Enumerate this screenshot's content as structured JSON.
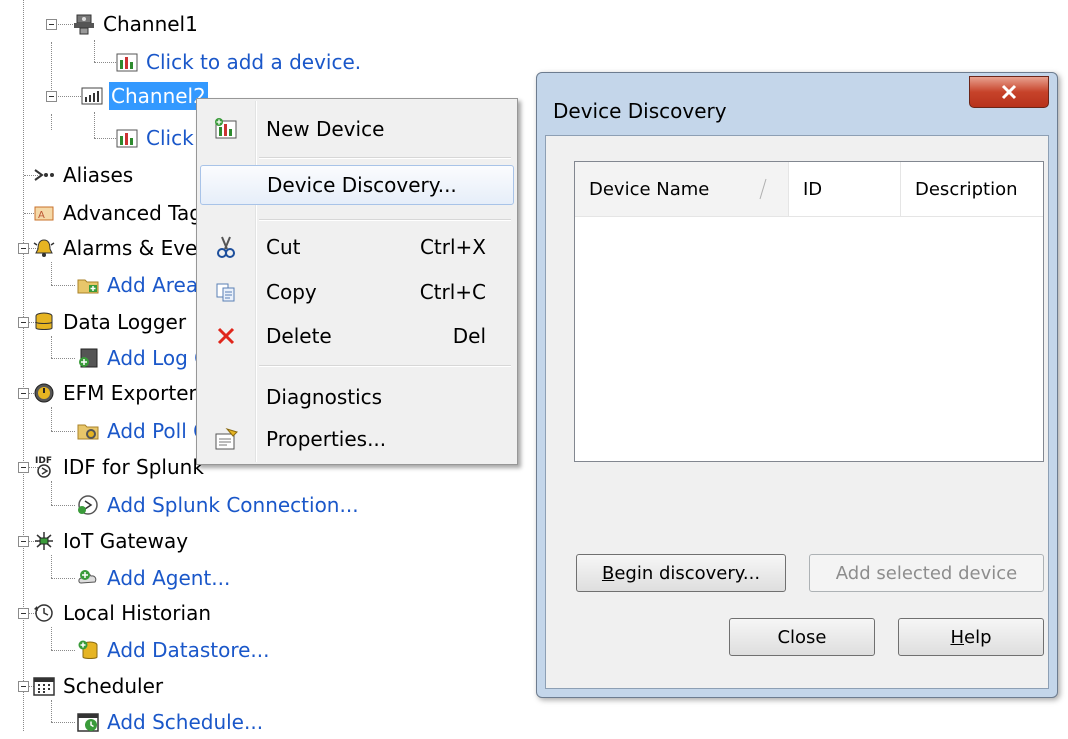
{
  "tree": {
    "items": [
      {
        "label": "Channel1",
        "icon": "serial-channel-icon"
      },
      {
        "label": "Click to add a device.",
        "icon": "add-device-icon"
      },
      {
        "label": "Channel2",
        "icon": "ethernet-channel-icon"
      },
      {
        "label": "Click to add a device.",
        "icon": "add-device-icon"
      },
      {
        "label": "Aliases",
        "icon": "aliases-icon"
      },
      {
        "label": "Advanced Tags",
        "icon": "advanced-tags-icon"
      },
      {
        "label": "Alarms & Events",
        "icon": "alarm-bell-icon"
      },
      {
        "label": "Add Area...",
        "icon": "add-area-folder-icon"
      },
      {
        "label": "Data Logger",
        "icon": "data-logger-icon"
      },
      {
        "label": "Add Log Group...",
        "icon": "add-log-group-icon"
      },
      {
        "label": "EFM Exporter",
        "icon": "efm-exporter-icon"
      },
      {
        "label": "Add Poll Group...",
        "icon": "add-poll-group-icon"
      },
      {
        "label": "IDF for Splunk",
        "icon": "idf-splunk-icon"
      },
      {
        "label": "Add Splunk Connection...",
        "icon": "add-splunk-connection-icon"
      },
      {
        "label": "IoT Gateway",
        "icon": "iot-gateway-icon"
      },
      {
        "label": "Add Agent...",
        "icon": "add-agent-icon"
      },
      {
        "label": "Local Historian",
        "icon": "local-historian-icon"
      },
      {
        "label": "Add Datastore...",
        "icon": "add-datastore-icon"
      },
      {
        "label": "Scheduler",
        "icon": "scheduler-calendar-icon"
      },
      {
        "label": "Add Schedule...",
        "icon": "add-schedule-icon"
      }
    ]
  },
  "context_menu": {
    "items": [
      {
        "label": "New Device",
        "shortcut": "",
        "icon": "new-device-icon"
      },
      {
        "label": "Device Discovery...",
        "shortcut": "",
        "icon": ""
      },
      {
        "label": "Cut",
        "shortcut": "Ctrl+X",
        "icon": "scissors-icon"
      },
      {
        "label": "Copy",
        "shortcut": "Ctrl+C",
        "icon": "copy-icon"
      },
      {
        "label": "Delete",
        "shortcut": "Del",
        "icon": "delete-x-icon"
      },
      {
        "label": "Diagnostics",
        "shortcut": "",
        "icon": ""
      },
      {
        "label": "Properties...",
        "shortcut": "",
        "icon": "properties-icon"
      }
    ],
    "hovered": "Device Discovery..."
  },
  "dialog": {
    "title": "Device Discovery",
    "columns": [
      "Device Name",
      "ID",
      "Description"
    ],
    "sorted_column": "Device Name",
    "buttons": {
      "begin_discovery": {
        "label_underlined": "B",
        "label_rest": "egin discovery..."
      },
      "add_selected_device": {
        "label": "Add selected device",
        "enabled": false
      },
      "close": {
        "label": "Close"
      },
      "help": {
        "label_underlined": "H",
        "label_rest": "elp"
      }
    }
  },
  "colors": {
    "link": "#1a57c9",
    "selection": "#3399ff",
    "dialog_frame": "#c4d6ea",
    "close_button": "#c7432a"
  }
}
